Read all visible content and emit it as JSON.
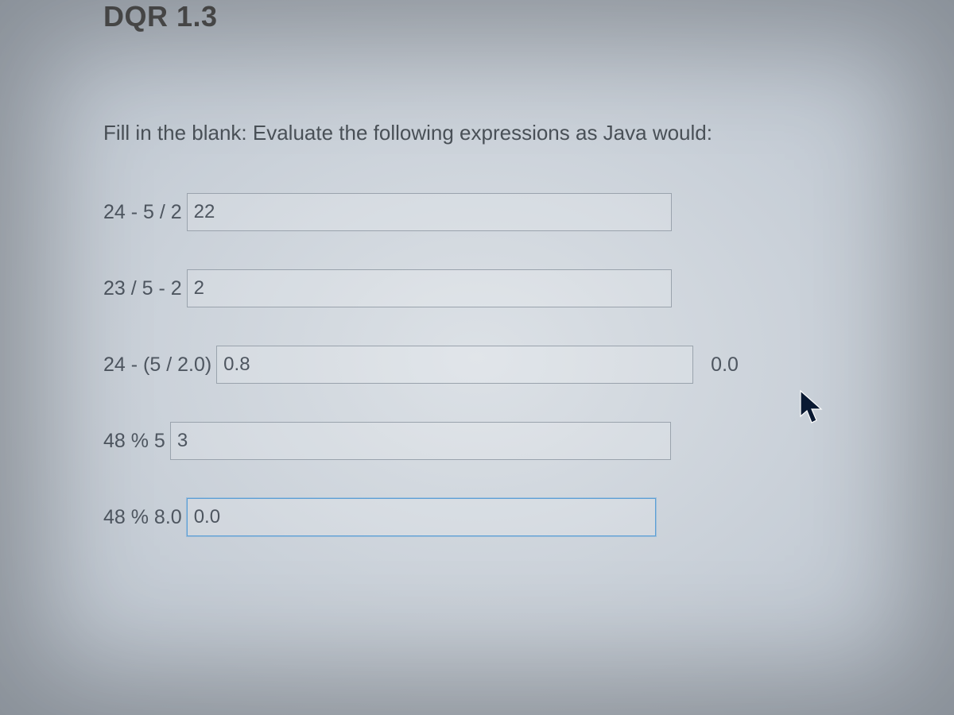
{
  "header": {
    "title": "DQR 1.3"
  },
  "prompt": "Fill in the blank: Evaluate the following expressions as Java would:",
  "questions": [
    {
      "label": "24 - 5 / 2",
      "value": "22",
      "extra": ""
    },
    {
      "label": "23 / 5 - 2",
      "value": "2",
      "extra": ""
    },
    {
      "label": "24 - (5 / 2.0)",
      "value": "0.8",
      "extra": "0.0"
    },
    {
      "label": "48 % 5",
      "value": "3",
      "extra": ""
    },
    {
      "label": "48 % 8.0",
      "value": "0.0",
      "extra": "",
      "focused": true
    }
  ]
}
